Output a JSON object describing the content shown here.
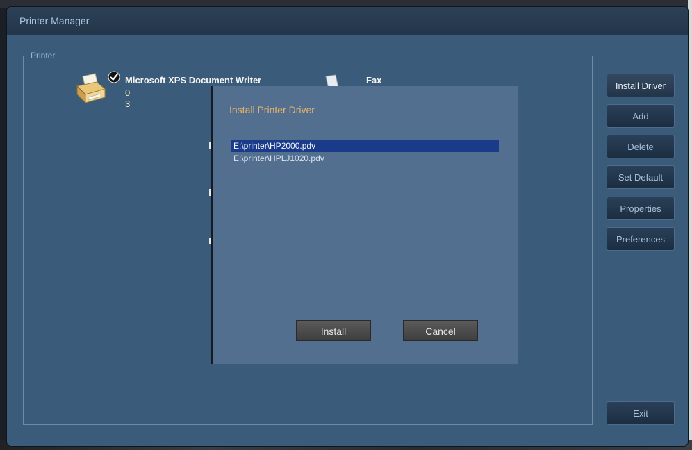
{
  "window": {
    "title": "Printer Manager"
  },
  "printer_group": {
    "label": "Printer"
  },
  "printers": [
    {
      "name": "Microsoft XPS Document Writer",
      "value1": "0",
      "value2": "3",
      "default": true
    },
    {
      "name": "Fax"
    }
  ],
  "side_buttons": {
    "install_driver": "Install Driver",
    "add": "Add",
    "delete": "Delete",
    "set_default": "Set Default",
    "properties": "Properties",
    "preferences": "Preferences",
    "exit": "Exit"
  },
  "dialog": {
    "title": "Install Printer Driver",
    "drivers": [
      "E:\\printer\\HP2000.pdv",
      "E:\\printer\\HPLJ1020.pdv"
    ],
    "selected_index": 0,
    "install_label": "Install",
    "cancel_label": "Cancel"
  },
  "colors": {
    "window_bg": "#3b5b7a",
    "dialog_bg": "#536f90",
    "dialog_title": "#e8b46a",
    "selection": "#1a3b8a"
  },
  "icons": [
    "printer-icon",
    "default-check-icon",
    "fax-icon"
  ]
}
